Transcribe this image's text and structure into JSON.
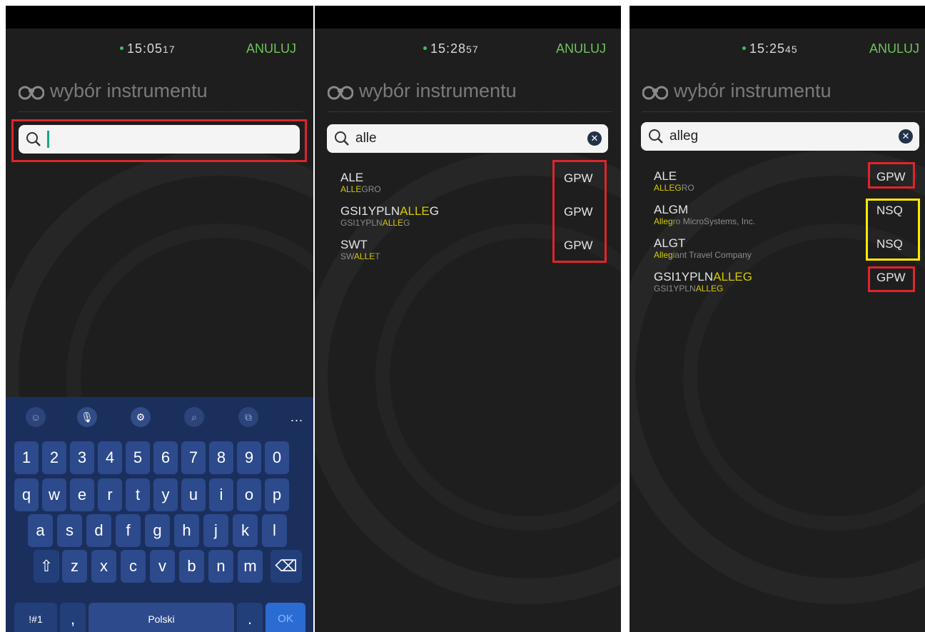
{
  "panels": [
    {
      "clock": {
        "hm": "15:05",
        "sec": "17"
      },
      "cancel_label": "ANULUJ",
      "title": "wybór instrumentu",
      "search": {
        "value": ""
      },
      "keyboard": {
        "tools": [
          "emoji-icon",
          "microphone-icon",
          "settings-icon",
          "search-icon",
          "clipboard-icon"
        ],
        "more": "...",
        "row_numbers": [
          "1",
          "2",
          "3",
          "4",
          "5",
          "6",
          "7",
          "8",
          "9",
          "0"
        ],
        "row1": [
          "q",
          "w",
          "e",
          "r",
          "t",
          "y",
          "u",
          "i",
          "o",
          "p"
        ],
        "row2": [
          "a",
          "s",
          "d",
          "f",
          "g",
          "h",
          "j",
          "k",
          "l"
        ],
        "row3": [
          "z",
          "x",
          "c",
          "v",
          "b",
          "n",
          "m"
        ],
        "symbols_label": "!#1",
        "comma": ",",
        "space_label": "Polski",
        "period": ".",
        "ok_label": "OK"
      }
    },
    {
      "clock": {
        "hm": "15:28",
        "sec": "57"
      },
      "cancel_label": "ANULUJ",
      "title": "wybór instrumentu",
      "search": {
        "value": "alle"
      },
      "results": [
        {
          "symbol_pre": "ALE",
          "symbol_hl": "",
          "symbol_post": "",
          "name_pre": "",
          "name_hl": "ALLE",
          "name_post": "GRO",
          "exchange": "GPW"
        },
        {
          "symbol_pre": "GSI1YPLN",
          "symbol_hl": "ALLE",
          "symbol_post": "G",
          "name_pre": "GSI1YPLN",
          "name_hl": "ALLE",
          "name_post": "G",
          "exchange": "GPW"
        },
        {
          "symbol_pre": "SWT",
          "symbol_hl": "",
          "symbol_post": "",
          "name_pre": "SW",
          "name_hl": "ALLE",
          "name_post": "T",
          "exchange": "GPW"
        }
      ]
    },
    {
      "clock": {
        "hm": "15:25",
        "sec": "45"
      },
      "cancel_label": "ANULUJ",
      "title": "wybór instrumentu",
      "search": {
        "value": "alleg"
      },
      "results": [
        {
          "symbol_pre": "ALE",
          "symbol_hl": "",
          "symbol_post": "",
          "name_pre": "",
          "name_hl": "ALLEG",
          "name_post": "RO",
          "exchange": "GPW"
        },
        {
          "symbol_pre": "ALGM",
          "symbol_hl": "",
          "symbol_post": "",
          "name_pre": "",
          "name_hl": "Alleg",
          "name_post": "ro MicroSystems, Inc.",
          "exchange": "NSQ"
        },
        {
          "symbol_pre": "ALGT",
          "symbol_hl": "",
          "symbol_post": "",
          "name_pre": "",
          "name_hl": "Alleg",
          "name_post": "iant Travel Company",
          "exchange": "NSQ"
        },
        {
          "symbol_pre": "GSI1YPLN",
          "symbol_hl": "ALLEG",
          "symbol_post": "",
          "name_pre": "GSI1YPLN",
          "name_hl": "ALLEG",
          "name_post": "",
          "exchange": "GPW"
        }
      ]
    }
  ],
  "colors": {
    "background": "#1e1e1e",
    "accent_green": "#6dc45a",
    "highlight": "#d5c900",
    "annotation_red": "#e0242b",
    "annotation_yellow": "#ffea00",
    "keyboard": "#1b2f5d"
  }
}
